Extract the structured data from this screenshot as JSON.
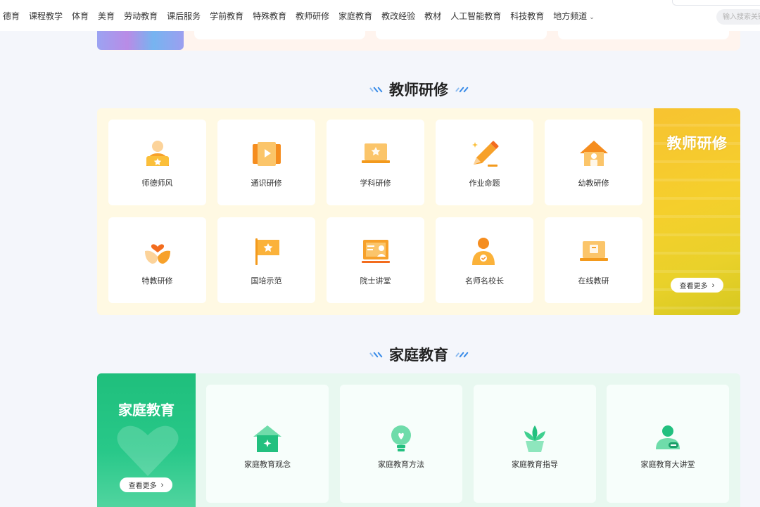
{
  "nav": {
    "items": [
      "德育",
      "课程教学",
      "体育",
      "美育",
      "劳动教育",
      "课后服务",
      "学前教育",
      "特殊教育",
      "教师研修",
      "家庭教育",
      "教改经验",
      "教材",
      "人工智能教育",
      "科技教育",
      "地方频道"
    ],
    "search_placeholder": "输入搜索关键"
  },
  "teacher": {
    "title": "教师研修",
    "banner_title": "教师研修",
    "more_label": "查看更多",
    "cards": [
      {
        "label": "师德师风",
        "icon": "teacher-badge-icon"
      },
      {
        "label": "通识研修",
        "icon": "video-film-icon"
      },
      {
        "label": "学科研修",
        "icon": "laptop-star-icon"
      },
      {
        "label": "作业命题",
        "icon": "pencil-icon"
      },
      {
        "label": "幼教研修",
        "icon": "kindergarten-house-icon"
      },
      {
        "label": "特教研修",
        "icon": "heart-hands-icon"
      },
      {
        "label": "国培示范",
        "icon": "flag-star-icon"
      },
      {
        "label": "院士讲堂",
        "icon": "lecture-board-icon"
      },
      {
        "label": "名师名校长",
        "icon": "person-badge-icon"
      },
      {
        "label": "在线教研",
        "icon": "online-screen-icon"
      }
    ]
  },
  "family": {
    "title": "家庭教育",
    "banner_title": "家庭教育",
    "more_label": "查看更多",
    "cards": [
      {
        "label": "家庭教育观念",
        "icon": "home-sparkle-icon"
      },
      {
        "label": "家庭教育方法",
        "icon": "lightbulb-heart-icon"
      },
      {
        "label": "家庭教育指导",
        "icon": "plant-pot-icon"
      },
      {
        "label": "家庭教育大讲堂",
        "icon": "speaker-person-icon"
      }
    ]
  },
  "colors": {
    "teacher_accent": "#f5a31a",
    "teacher_panel_bg": "#fff9e3",
    "family_accent": "#1fbf7c",
    "family_panel_bg": "#e8f8f0",
    "title_deco": "#3a8ce8"
  }
}
